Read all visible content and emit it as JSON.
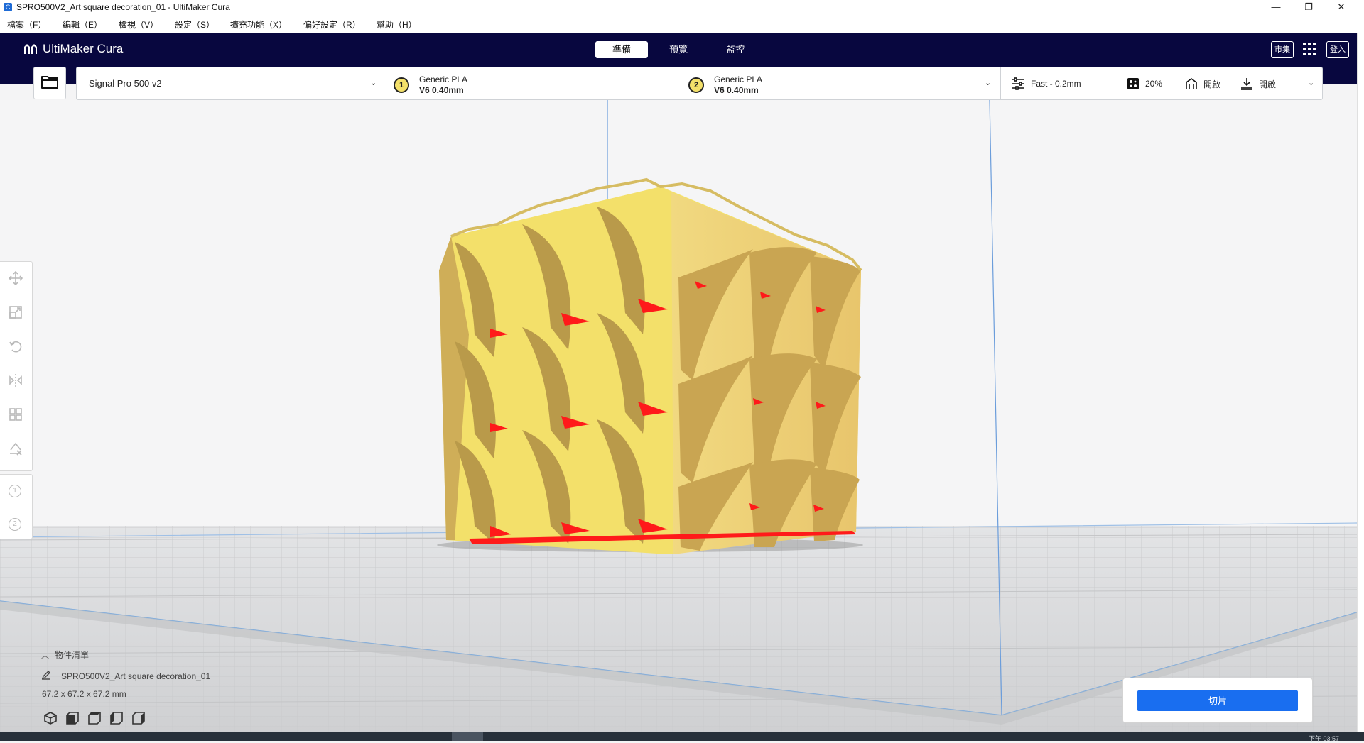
{
  "window": {
    "title": "SPRO500V2_Art square decoration_01 - UltiMaker Cura",
    "app_icon": "C",
    "controls": [
      "—",
      "❐",
      "✕"
    ]
  },
  "menu": [
    "檔案（F）",
    "編輯（E）",
    "檢視（V）",
    "設定（S）",
    "擴充功能（X）",
    "偏好設定（R）",
    "幫助（H）"
  ],
  "header": {
    "brand": "UltiMaker Cura",
    "tabs": [
      "準備",
      "預覽",
      "監控"
    ],
    "active_tab": "準備",
    "marketplace": "市集",
    "signin": "登入",
    "bg_color": "#08073f"
  },
  "printer": {
    "name": "Signal Pro 500 v2"
  },
  "extruders": [
    {
      "num": "1",
      "material": "Generic PLA",
      "nozzle": "V6 0.40mm"
    },
    {
      "num": "2",
      "material": "Generic PLA",
      "nozzle": "V6 0.40mm"
    }
  ],
  "print_settings": {
    "profile": "Fast - 0.2mm",
    "infill": "20%",
    "support": "開啟",
    "adhesion": "開啟"
  },
  "object_list": {
    "header": "物件清單",
    "object_name": "SPRO500V2_Art square decoration_01",
    "dimensions": "67.2 x 67.2 x 67.2 mm"
  },
  "slice": {
    "label": "切片",
    "color": "#196ef0"
  },
  "status": {
    "time": "下午 03:57"
  },
  "model": {
    "face_color": "#f3e06a",
    "overhang_color": "#ff1a1a"
  }
}
